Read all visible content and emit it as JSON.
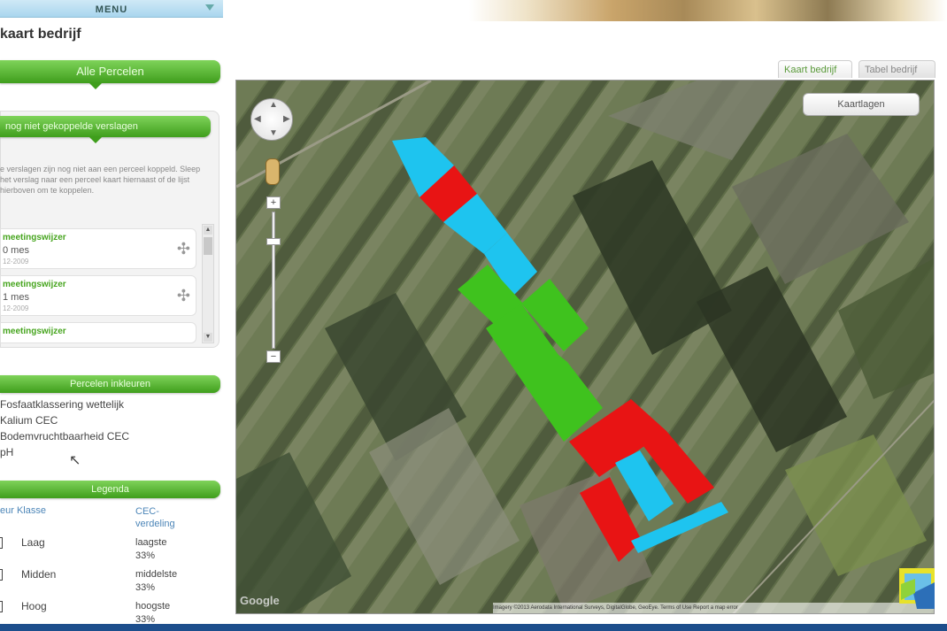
{
  "menu": {
    "label": "MENU"
  },
  "page": {
    "title": "kaart bedrijf"
  },
  "tabs": [
    {
      "label": "Kaart bedrijf",
      "active": true
    },
    {
      "label": "Tabel bedrijf",
      "active": false
    }
  ],
  "sidebar": {
    "all_parcels_label": "Alle Percelen",
    "unlinked_header": "nog niet gekoppelde verslagen",
    "unlinked_text": "e verslagen zijn nog niet aan een perceel koppeld. Sleep het verslag naar een perceel kaart hiernaast of de lijst hierboven om te koppelen.",
    "items": [
      {
        "title": "meetingswijzer",
        "value": "0 mes",
        "date": "12-2009"
      },
      {
        "title": "meetingswijzer",
        "value": "1 mes",
        "date": "12-2009"
      },
      {
        "title": "meetingswijzer",
        "value": "",
        "date": ""
      }
    ],
    "layers_header": "Percelen inkleuren",
    "layers": [
      "Fosfaatklassering wettelijk",
      "Kalium CEC",
      "Bodemvruchtbaarheid CEC",
      "pH"
    ],
    "legend_header": "Legenda",
    "legend_columns": {
      "class": "eur Klasse",
      "distribution": "CEC-verdeling"
    },
    "legend_rows": [
      {
        "class": "Laag",
        "distribution": "laagste",
        "percent": "33%"
      },
      {
        "class": "Midden",
        "distribution": "middelste",
        "percent": "33%"
      },
      {
        "class": "Hoog",
        "distribution": "hoogste",
        "percent": "33%"
      }
    ]
  },
  "map": {
    "layers_button": "Kaartlagen",
    "google_logo": "Google",
    "attribution": "Imagery ©2013 Aerodata International Surveys, DigitalGlobe, GeoEye. Terms of Use  Report a map error",
    "colors": {
      "low": "#e81414",
      "medium": "#3fc21e",
      "high": "#1ec4ef"
    }
  }
}
